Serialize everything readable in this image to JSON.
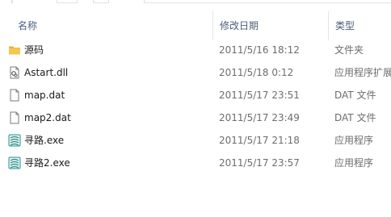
{
  "columns": {
    "name": "名称",
    "date": "修改日期",
    "type": "类型"
  },
  "files": [
    {
      "name": "源码",
      "date": "2011/5/16 18:12",
      "type": "文件夹",
      "icon": "folder-icon"
    },
    {
      "name": "Astart.dll",
      "date": "2011/5/18 0:12",
      "type": "应用程序扩展",
      "icon": "dll-file-icon"
    },
    {
      "name": "map.dat",
      "date": "2011/5/17 23:51",
      "type": "DAT 文件",
      "icon": "blank-file-icon"
    },
    {
      "name": "map2.dat",
      "date": "2011/5/17 23:49",
      "type": "DAT 文件",
      "icon": "blank-file-icon"
    },
    {
      "name": "寻路.exe",
      "date": "2011/5/17 21:18",
      "type": "应用程序",
      "icon": "exe-app-icon"
    },
    {
      "name": "寻路2.exe",
      "date": "2011/5/17 23:57",
      "type": "应用程序",
      "icon": "exe-app-icon"
    }
  ],
  "colors": {
    "header_text": "#4c607a",
    "secondary_text": "#6d6d6d",
    "folder": "#f6c651",
    "exe_icon": "#2a8f8a"
  }
}
